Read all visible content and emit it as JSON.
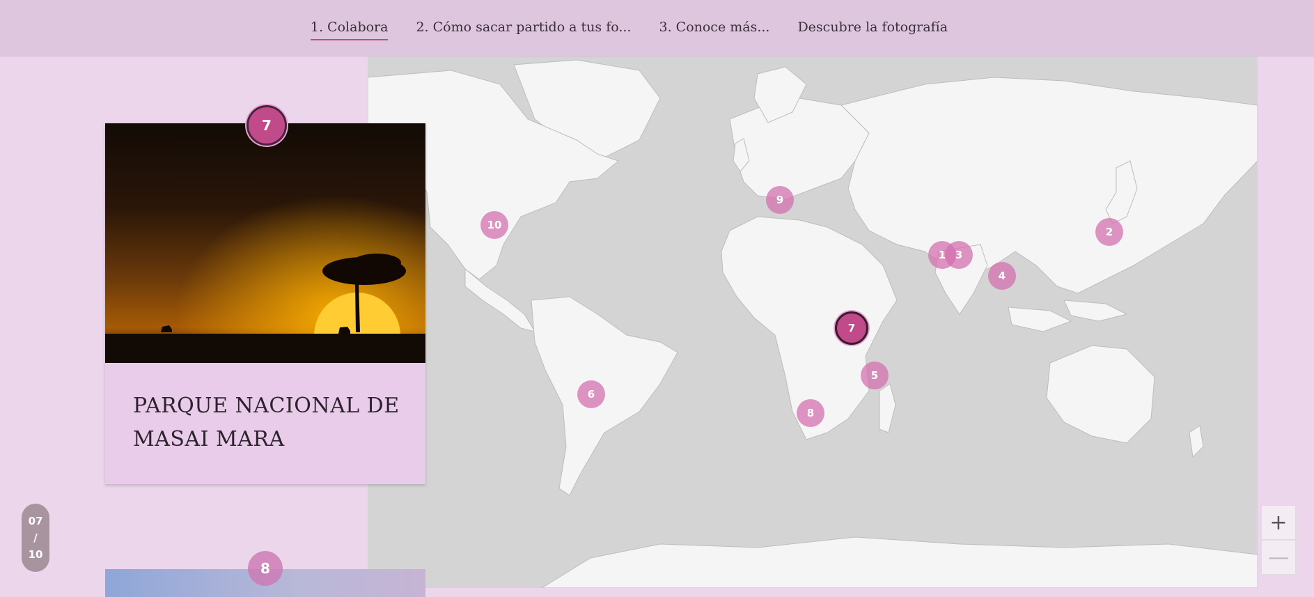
{
  "nav": {
    "tabs": [
      {
        "label": "1. Colabora",
        "active": true
      },
      {
        "label": "2. Cómo sacar partido a tus fo...",
        "active": false
      },
      {
        "label": "3. Conoce más...",
        "active": false
      },
      {
        "label": "Descubre la fotografía",
        "active": false
      }
    ]
  },
  "story": {
    "current": {
      "number": "7",
      "title": "PARQUE NACIONAL DE MASAI MARA"
    },
    "next": {
      "number": "8"
    },
    "counter": {
      "current": "07",
      "separator": "/",
      "total": "10"
    }
  },
  "map": {
    "markers": [
      "1",
      "2",
      "3",
      "4",
      "5",
      "6",
      "7",
      "8",
      "9",
      "10"
    ],
    "active_marker": "7",
    "zoom_in_icon": "plus-icon",
    "zoom_out_icon": "minus-icon",
    "colors": {
      "marker": "#d26eaf",
      "active_marker": "#c04a8a",
      "water": "#d4d4d4",
      "land": "#f5f5f5"
    }
  }
}
